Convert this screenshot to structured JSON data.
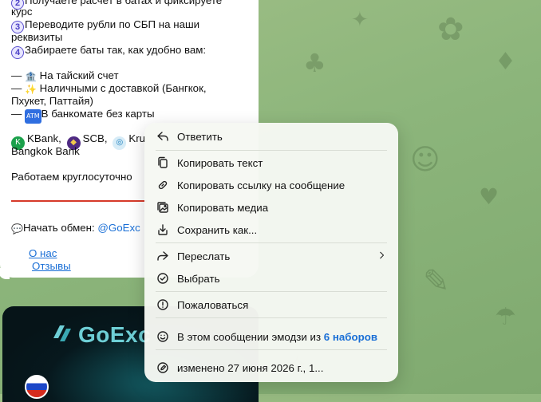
{
  "message": {
    "lines": [
      {
        "text": "Получаете расчёт в батах и фиксируете",
        "num": "2"
      },
      {
        "text": "курс"
      },
      {
        "text": "Переводите рубли по СБП на наши",
        "num": "3"
      },
      {
        "text": "реквизиты"
      },
      {
        "text": "Забираете баты так, как удобно вам:",
        "num": "4"
      }
    ],
    "options": [
      {
        "dash": "—",
        "icon": "bank-building-icon",
        "text": "На тайский счет"
      },
      {
        "dash": "—",
        "icon": "sparkle-icon",
        "text": "Наличными с доставкой (Бангкок,"
      },
      {
        "text": "Пхукет, Паттайя)"
      },
      {
        "dash": "—",
        "icon": "atm-icon",
        "text": "В банкомате без карты"
      }
    ],
    "banks": {
      "kbank": "KBank,",
      "scb": "SCB,",
      "krungsri": "Kru",
      "second_line": "Bangkok Bank"
    },
    "hours": "Работаем круглосуточно",
    "start_label": "Начать обмен:",
    "start_handle": "@GoExc",
    "about_link": "О нас",
    "reviews_link": "Отзывы"
  },
  "image_card": {
    "logo_text": "GoExc"
  },
  "context_menu": {
    "items": [
      {
        "label": "Ответить",
        "icon": "reply-icon"
      },
      {
        "label": "Копировать текст",
        "icon": "copy-icon"
      },
      {
        "label": "Копировать ссылку на сообщение",
        "icon": "link-icon"
      },
      {
        "label": "Копировать медиа",
        "icon": "image-copy-icon"
      },
      {
        "label": "Сохранить как...",
        "icon": "download-icon"
      },
      {
        "label": "Переслать",
        "icon": "forward-icon"
      },
      {
        "label": "Выбрать",
        "icon": "check-circle-icon"
      },
      {
        "label": "Пожаловаться",
        "icon": "report-icon"
      }
    ],
    "emoji_text": "В этом сообщении эмодзи из",
    "emoji_link": "6 наборов",
    "edited_text": "изменено 27 июня 2026 г., 1..."
  },
  "colors": {
    "accent_link": "#1a6fd6",
    "divider_red": "#d63a2a",
    "number_badge": "#4b40c6",
    "chat_background": "#8cb57b"
  }
}
